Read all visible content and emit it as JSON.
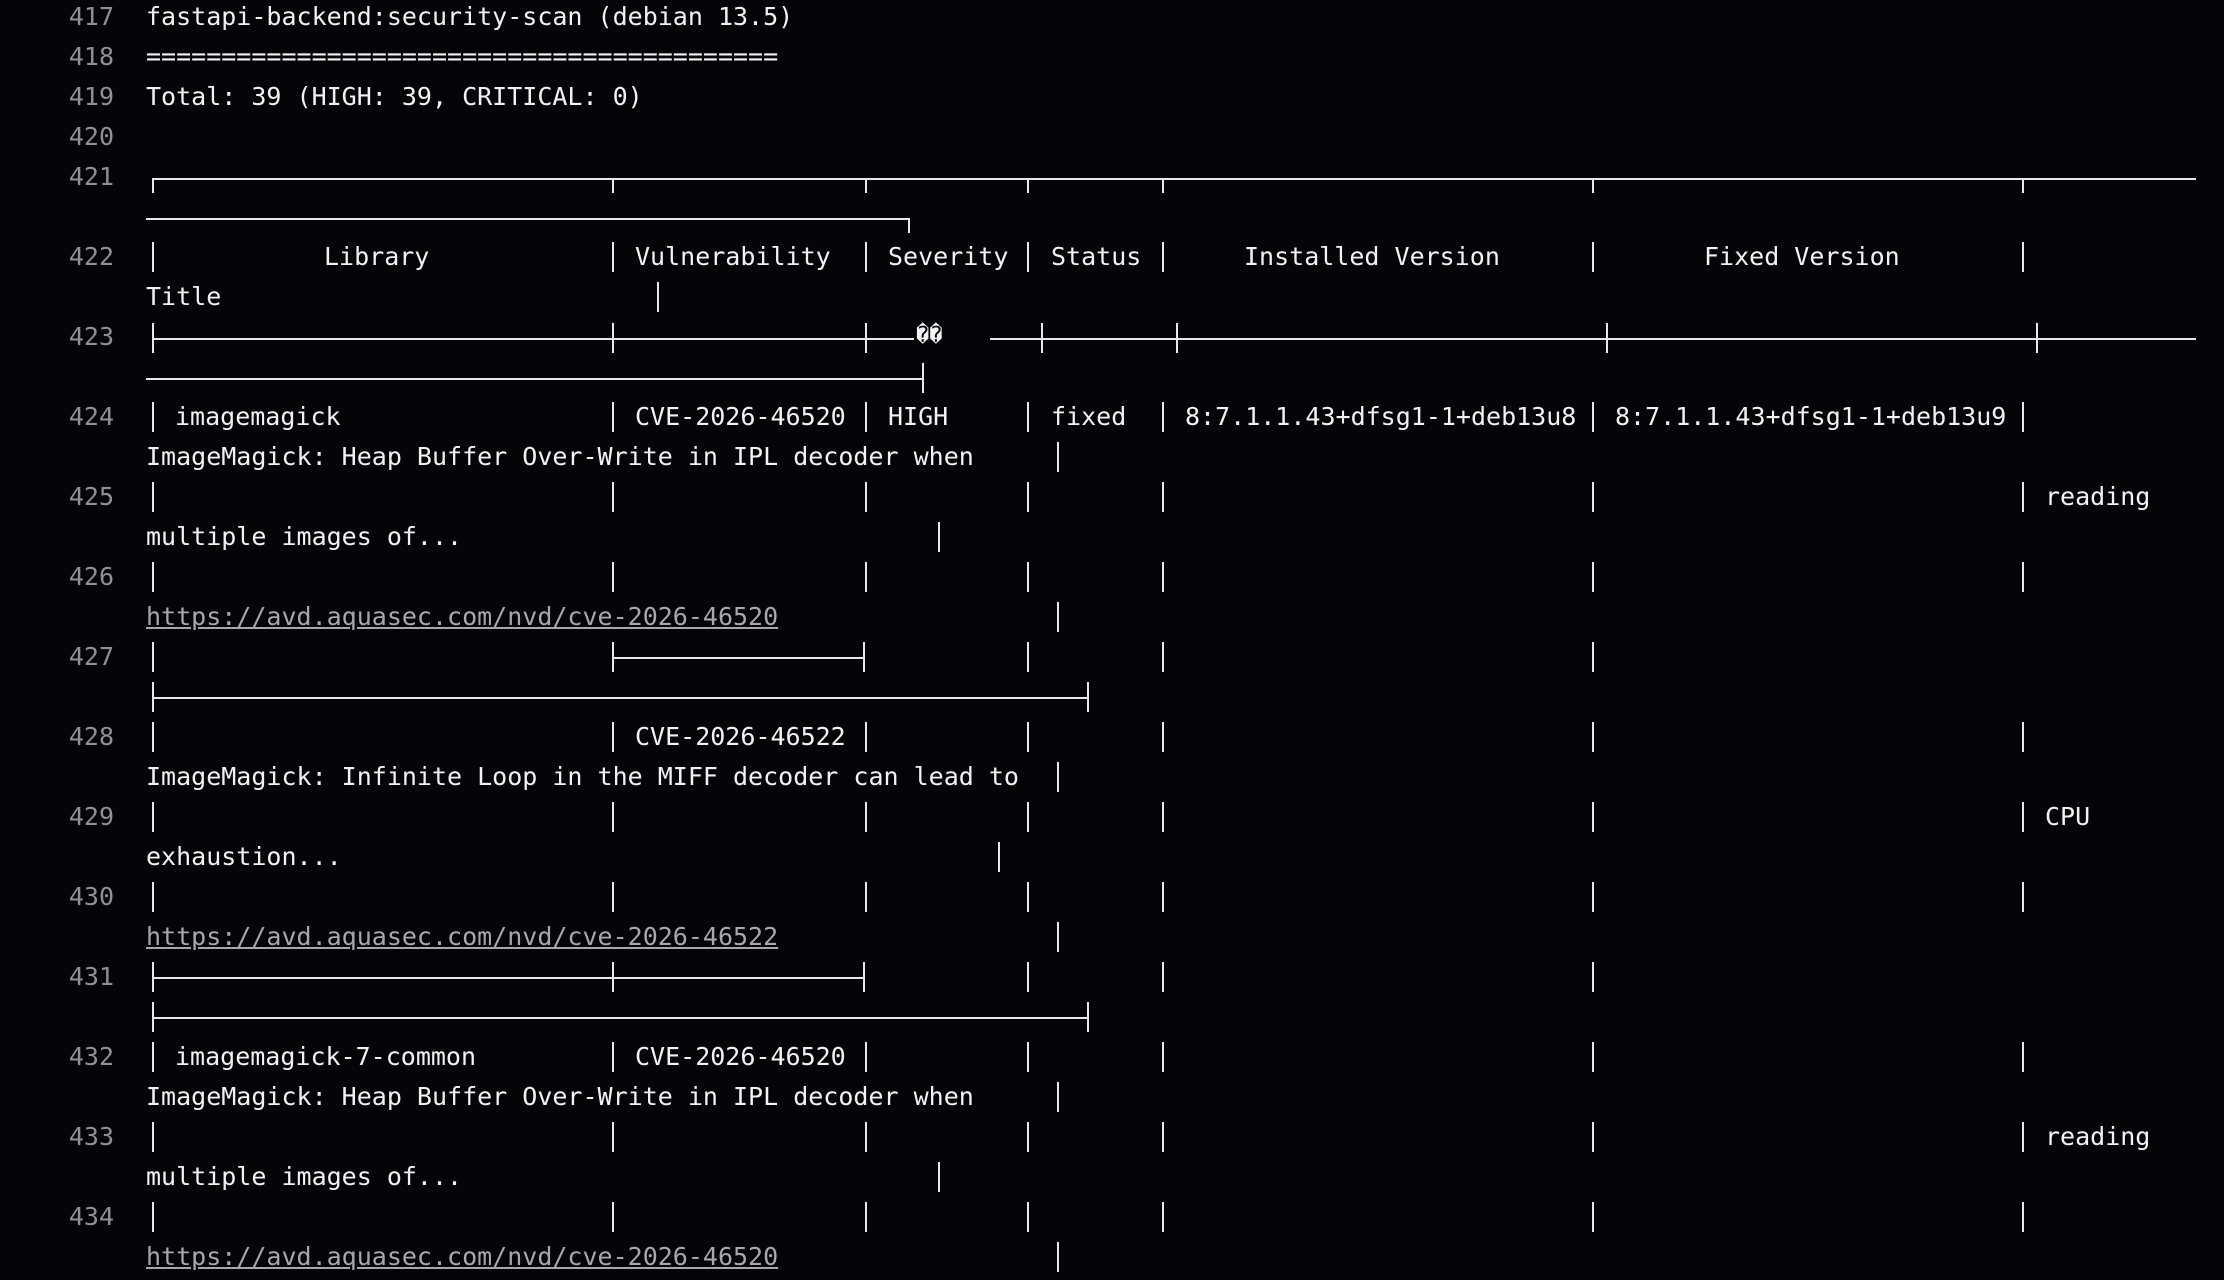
{
  "terminal": {
    "line_numbers": [
      "417",
      "418",
      "419",
      "420",
      "421",
      "422",
      "423",
      "424",
      "425",
      "426",
      "427",
      "428",
      "429",
      "430",
      "431",
      "432",
      "433",
      "434"
    ],
    "header": {
      "target": "fastapi-backend:security-scan (debian 13.5)",
      "rule": "==========================================",
      "total": "Total: 39 (HIGH: 39, CRITICAL: 0)"
    },
    "columns": {
      "library": "Library",
      "vulnerability": "Vulnerability",
      "severity": "Severity",
      "status": "Status",
      "installed": "Installed Version",
      "fixed": "Fixed Version",
      "title": "Title"
    },
    "replacement_glyph": "��",
    "rows": [
      {
        "library": "imagemagick",
        "cve": "CVE-2026-46520",
        "severity": "HIGH",
        "status": "fixed",
        "installed": "8:7.1.1.43+dfsg1-1+deb13u8",
        "fixed": "8:7.1.1.43+dfsg1-1+deb13u9",
        "title_1": "ImageMagick: Heap Buffer Over-Write in IPL decoder when",
        "title_tail": "reading",
        "title_2": "multiple images of...",
        "link": "https://avd.aquasec.com/nvd/cve-2026-46520"
      },
      {
        "library": "",
        "cve": "CVE-2026-46522",
        "title_1": "ImageMagick: Infinite Loop in the MIFF decoder can lead to",
        "title_tail": "CPU",
        "title_2": "exhaustion...",
        "link": "https://avd.aquasec.com/nvd/cve-2026-46522"
      },
      {
        "library": "imagemagick-7-common",
        "cve": "CVE-2026-46520",
        "title_1": "ImageMagick: Heap Buffer Over-Write in IPL decoder when",
        "title_tail": "reading",
        "title_2": "multiple images of...",
        "link": "https://avd.aquasec.com/nvd/cve-2026-46520"
      }
    ]
  }
}
